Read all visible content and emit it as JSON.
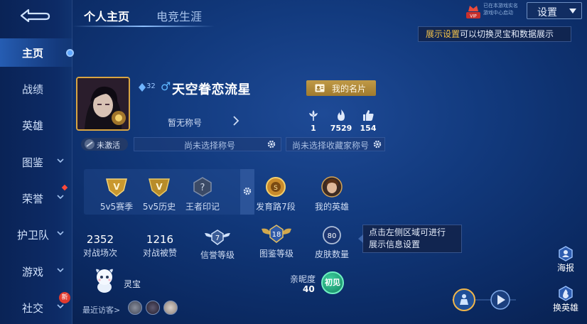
{
  "tabs": [
    {
      "label": "个人主页",
      "active": true
    },
    {
      "label": "电竞生涯",
      "active": false
    }
  ],
  "sidebar": {
    "items": [
      {
        "label": "主页",
        "active": true
      },
      {
        "label": "战绩"
      },
      {
        "label": "英雄"
      },
      {
        "label": "图鉴"
      },
      {
        "label": "荣誉"
      },
      {
        "label": "护卫队"
      },
      {
        "label": "游戏"
      },
      {
        "label": "社交"
      }
    ],
    "new_badge": "新"
  },
  "header": {
    "vip_label": "VIP",
    "vip_note_line1": "已在本游戏实名",
    "vip_note_line2": "游戏中心启动",
    "settings_label": "设置"
  },
  "tip_top": {
    "highlight": "展示设置",
    "text": "可以切换灵宝和数据展示"
  },
  "profile": {
    "level": "32",
    "gender_icon": "♂",
    "name": "天空眷恋流星",
    "card_button": "我的名片",
    "inactive_badge": "未激活",
    "title_text": "暂无称号",
    "title_select_placeholder": "尚未选择称号",
    "collector_select_placeholder": "尚未选择收藏家称号",
    "stats": [
      {
        "icon": "flower-icon",
        "value": "1"
      },
      {
        "icon": "flame-icon",
        "value": "7529"
      },
      {
        "icon": "thumbs-up-icon",
        "value": "154"
      }
    ]
  },
  "panel_items": [
    {
      "label": "5v5赛季",
      "icon": "season-badge-icon"
    },
    {
      "label": "5v5历史",
      "icon": "history-badge-icon"
    },
    {
      "label": "王者印记",
      "icon": "king-mark-icon"
    },
    {
      "label": "发育路7段",
      "icon": "lane-rank-icon"
    },
    {
      "label": "我的英雄",
      "icon": "hero-portrait-icon"
    }
  ],
  "stats_row": {
    "matches_value": "2352",
    "matches_label": "对战场次",
    "mvp_value": "1216",
    "mvp_label": "对战被赞",
    "credit_value": "7",
    "credit_label": "信誉等级",
    "codex_value": "18",
    "codex_label": "图鉴等级",
    "skins_value": "80",
    "skins_label": "皮肤数量"
  },
  "tip_mid": {
    "line1": "点击左侧区域可进行",
    "line2": "展示信息设置"
  },
  "companion": {
    "pet_name": "灵宝",
    "intimacy_label": "亲昵度",
    "intimacy_value": "40",
    "stage_badge": "初见"
  },
  "visitors_label": "最近访客>",
  "side_buttons": {
    "poster": "海报",
    "switch_hero": "换英雄"
  },
  "colors": {
    "accent_gold": "#d9a542",
    "highlight_text": "#f4c34a",
    "active_nav": "#5da6ff"
  }
}
